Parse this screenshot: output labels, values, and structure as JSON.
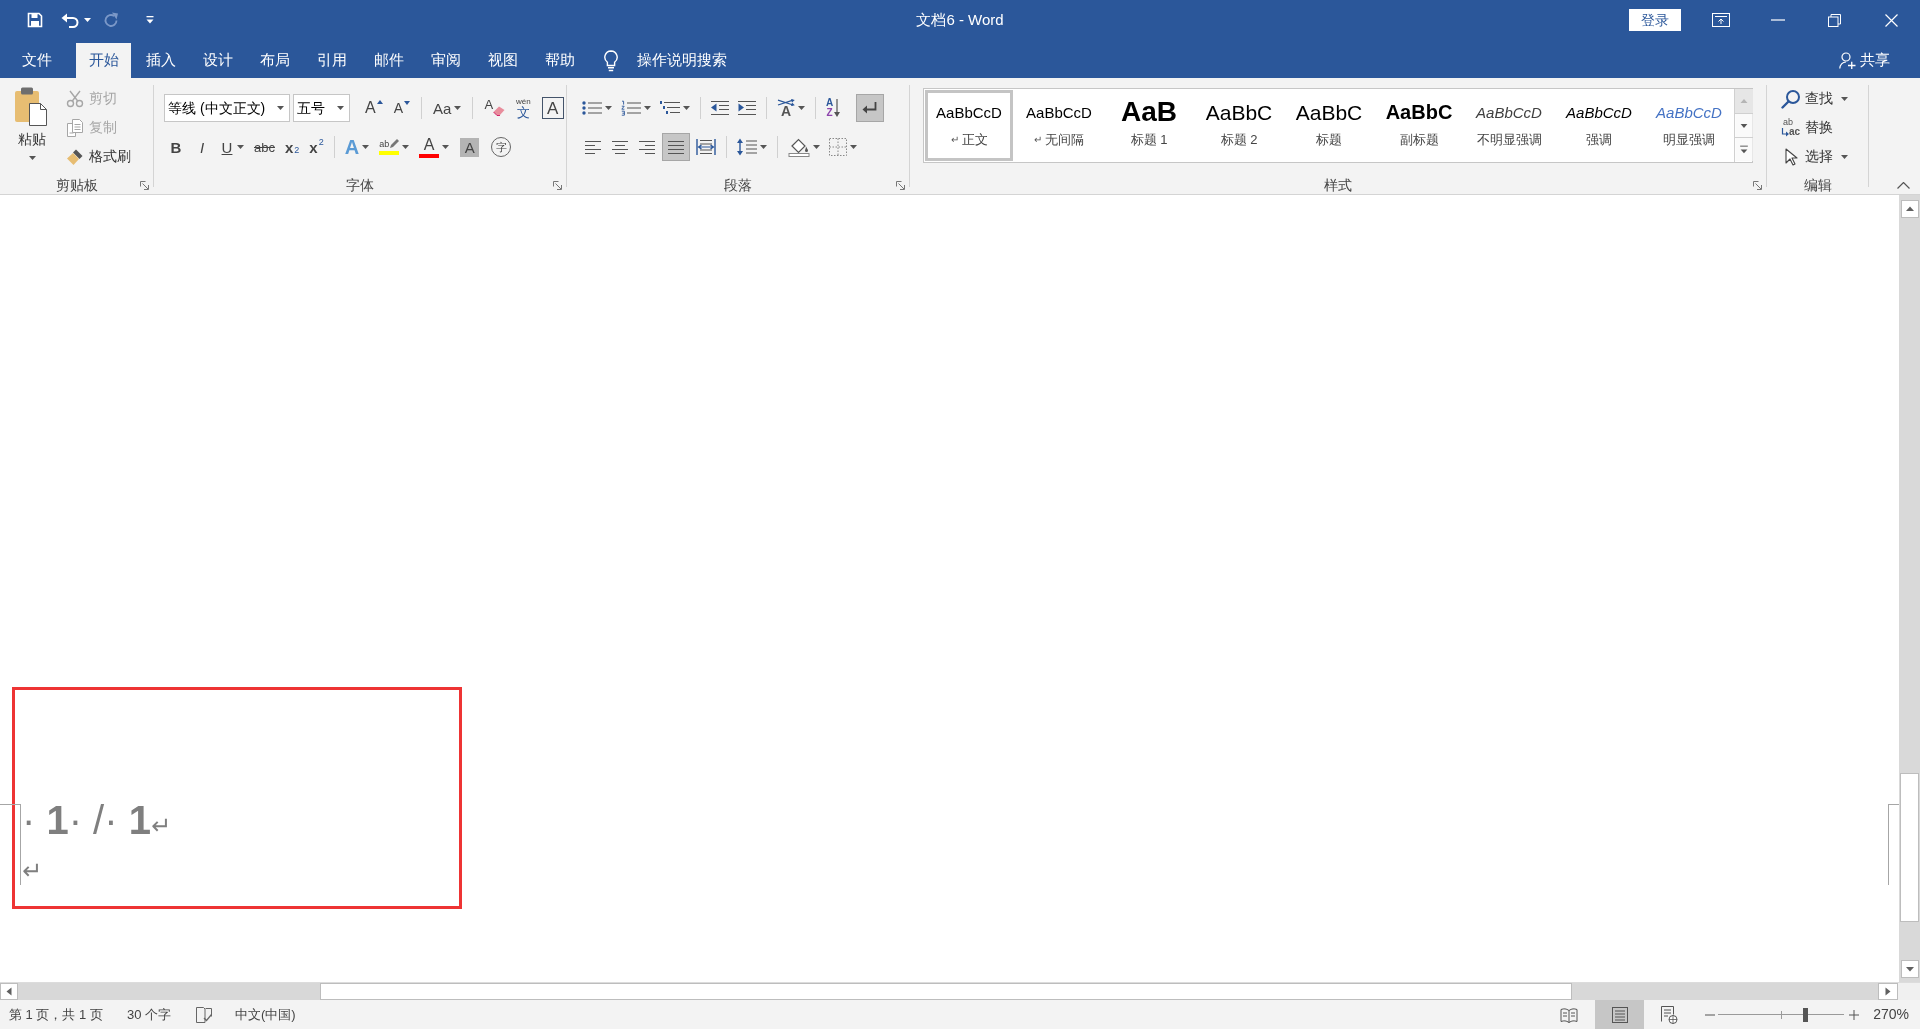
{
  "window": {
    "title": "文档6 - Word",
    "sign_in": "登录"
  },
  "quick_access": [
    {
      "kind": "save",
      "disabled": false
    },
    {
      "kind": "undo",
      "disabled": false,
      "menu": true
    },
    {
      "kind": "redo",
      "disabled": true
    },
    {
      "kind": "customize",
      "disabled": false
    }
  ],
  "tabs": [
    {
      "label": "文件",
      "selected": false
    },
    {
      "label": "开始",
      "selected": true
    },
    {
      "label": "插入",
      "selected": false
    },
    {
      "label": "设计",
      "selected": false
    },
    {
      "label": "布局",
      "selected": false
    },
    {
      "label": "引用",
      "selected": false
    },
    {
      "label": "邮件",
      "selected": false
    },
    {
      "label": "审阅",
      "selected": false
    },
    {
      "label": "视图",
      "selected": false
    },
    {
      "label": "帮助",
      "selected": false
    }
  ],
  "tell_me": {
    "label": "操作说明搜索"
  },
  "share": {
    "label": "共享"
  },
  "clipboard": {
    "label": "剪贴板",
    "paste": {
      "label": "粘贴"
    },
    "commands": [
      {
        "kind": "cut",
        "label": "剪切",
        "disabled": true
      },
      {
        "kind": "copy",
        "label": "复制",
        "disabled": true
      },
      {
        "kind": "format_painter",
        "label": "格式刷",
        "disabled": false
      }
    ]
  },
  "font": {
    "label": "字体",
    "font_name": "等线 (中文正文)",
    "font_size": "五号",
    "row_1": [
      {
        "kind": "grow",
        "glyph": "A"
      },
      {
        "kind": "shrink",
        "glyph": "A"
      },
      {
        "kind": "separator"
      },
      {
        "kind": "change_case",
        "glyph": "Aa",
        "menu": true
      },
      {
        "kind": "separator"
      },
      {
        "kind": "clear",
        "glyph": "A"
      },
      {
        "kind": "phonetic",
        "ruby": "wén",
        "glyph": "文"
      },
      {
        "kind": "border",
        "glyph": "A"
      }
    ],
    "row_2": [
      {
        "kind": "bold",
        "glyph": "B"
      },
      {
        "kind": "italic",
        "glyph": "I"
      },
      {
        "kind": "underline",
        "glyph": "U",
        "menu": true
      },
      {
        "kind": "strikethrough",
        "glyph": "abc"
      },
      {
        "kind": "subscript",
        "glyph": "x",
        "script": "2"
      },
      {
        "kind": "superscript",
        "glyph": "x",
        "script": "2"
      },
      {
        "kind": "separator"
      },
      {
        "kind": "effects",
        "glyph": "A",
        "menu": true
      },
      {
        "kind": "highlight",
        "glyph": "ab",
        "color": "#ffff00",
        "menu": true
      },
      {
        "kind": "font_color",
        "glyph": "A",
        "color": "#ff0000",
        "menu": true
      },
      {
        "kind": "shading",
        "glyph": "A"
      },
      {
        "kind": "enclose",
        "glyph": "字"
      }
    ]
  },
  "paragraph": {
    "label": "段落",
    "row_1": [
      {
        "kind": "bullets",
        "menu": true
      },
      {
        "kind": "numbering",
        "menu": true
      },
      {
        "kind": "multilevel",
        "menu": true
      },
      {
        "kind": "separator"
      },
      {
        "kind": "outdent"
      },
      {
        "kind": "indent"
      },
      {
        "kind": "separator"
      },
      {
        "kind": "asian_layout",
        "glyph": "A",
        "menu": true
      },
      {
        "kind": "separator"
      },
      {
        "kind": "sort",
        "glyph": "A",
        "glyph2": "Z"
      },
      {
        "kind": "show_marks",
        "on": true
      }
    ],
    "row_2": [
      {
        "kind": "align_left",
        "selected": false
      },
      {
        "kind": "align_center",
        "selected": false
      },
      {
        "kind": "align_right",
        "selected": false
      },
      {
        "kind": "justify",
        "selected": true
      },
      {
        "kind": "distributed",
        "selected": false
      },
      {
        "kind": "separator"
      },
      {
        "kind": "line_spacing",
        "menu": true
      },
      {
        "kind": "separator"
      },
      {
        "kind": "shading",
        "menu": true
      },
      {
        "kind": "borders",
        "menu": true
      }
    ]
  },
  "styles": {
    "label": "样式",
    "items": [
      {
        "kind": "normal",
        "preview": "AaBbCcD",
        "mark": "↵",
        "label": "正文",
        "selected": true
      },
      {
        "kind": "no_spacing",
        "preview": "AaBbCcD",
        "mark": "↵",
        "label": "无间隔",
        "selected": false
      },
      {
        "kind": "heading_1",
        "preview": "AaB",
        "label": "标题 1",
        "selected": false
      },
      {
        "kind": "heading_2",
        "preview": "AaBbC",
        "label": "标题 2",
        "selected": false
      },
      {
        "kind": "title",
        "preview": "AaBbC",
        "label": "标题",
        "selected": false
      },
      {
        "kind": "subtitle",
        "preview": "AaBbC",
        "label": "副标题",
        "selected": false
      },
      {
        "kind": "subtle_emphasis",
        "preview": "AaBbCcD",
        "label": "不明显强调",
        "selected": false
      },
      {
        "kind": "emphasis",
        "preview": "AaBbCcD",
        "label": "强调",
        "selected": false
      },
      {
        "kind": "intense_emphasis",
        "preview": "AaBbCcD",
        "label": "明显强调",
        "selected": false
      }
    ]
  },
  "editing": {
    "label": "编辑",
    "commands": [
      {
        "kind": "find",
        "label": "查找",
        "menu": true
      },
      {
        "kind": "replace",
        "label": "替换",
        "glyph": "ab",
        "glyph2": "ac"
      },
      {
        "kind": "select",
        "label": "选择",
        "menu": true
      }
    ]
  },
  "document": {
    "lines": [
      {
        "text": "· **1**· /· **1**",
        "mark": "↵"
      },
      {
        "mark": "↵"
      }
    ],
    "annotations": [
      {
        "kind": "rectangle"
      }
    ]
  },
  "status_bar": {
    "page": "第 1 页，共 1 页",
    "words": "30 个字",
    "language": "中文(中国)",
    "views": [
      {
        "kind": "read",
        "selected": false
      },
      {
        "kind": "print",
        "selected": true
      },
      {
        "kind": "web",
        "selected": false
      }
    ],
    "zoom": {
      "level": 0.69,
      "reading": "270%"
    }
  }
}
